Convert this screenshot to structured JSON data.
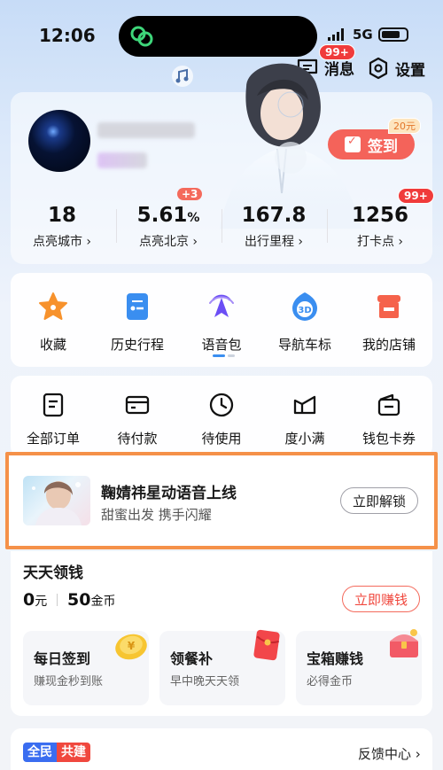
{
  "status_bar": {
    "time": "12:06",
    "network": "5G"
  },
  "header": {
    "messages_label": "消息",
    "messages_badge": "99+",
    "settings_label": "设置"
  },
  "profile": {
    "signin_label": "签到",
    "signin_reward": "20元"
  },
  "stats": [
    {
      "value": "18",
      "unit": "",
      "label": "点亮城市 ›"
    },
    {
      "value": "5.61",
      "unit": "%",
      "label": "点亮北京 ›",
      "badge": "+3"
    },
    {
      "value": "167.8",
      "unit": "",
      "label": "出行里程 ›"
    },
    {
      "value": "1256",
      "unit": "",
      "label": "打卡点 ›",
      "badge": "99+"
    }
  ],
  "shortcuts": [
    {
      "label": "收藏",
      "icon": "star-icon"
    },
    {
      "label": "历史行程",
      "icon": "history-trip-icon"
    },
    {
      "label": "语音包",
      "icon": "voice-pack-icon"
    },
    {
      "label": "导航车标",
      "icon": "car-marker-3d-icon"
    },
    {
      "label": "我的店铺",
      "icon": "shop-icon"
    }
  ],
  "orders": [
    {
      "label": "全部订单",
      "icon": "order-list-icon"
    },
    {
      "label": "待付款",
      "icon": "card-payment-icon"
    },
    {
      "label": "待使用",
      "icon": "clock-icon"
    },
    {
      "label": "度小满",
      "icon": "duxiaoman-icon"
    },
    {
      "label": "钱包卡券",
      "icon": "wallet-icon"
    }
  ],
  "promo": {
    "title": "鞠婧祎星动语音上线",
    "subtitle": "甜蜜出发 携手闪耀",
    "button": "立即解锁"
  },
  "money": {
    "title": "天天领钱",
    "cash_value": "0",
    "cash_unit": "元",
    "coins_value": "50",
    "coins_unit": "金币",
    "earn_button": "立即赚钱",
    "tasks": [
      {
        "title": "每日签到",
        "subtitle": "赚现金秒到账",
        "icon": "gold-coin-icon"
      },
      {
        "title": "领餐补",
        "subtitle": "早中晚天天领",
        "icon": "red-envelope-icon"
      },
      {
        "title": "宝箱赚钱",
        "subtitle": "必得金币",
        "icon": "treasure-chest-icon"
      }
    ]
  },
  "bottom": {
    "tag_left": "全民",
    "tag_right": "共建",
    "feedback": "反馈中心 ›"
  },
  "colors": {
    "accent_red": "#f4635a",
    "highlight_orange": "#f59149",
    "brand_blue": "#3a6df0"
  }
}
